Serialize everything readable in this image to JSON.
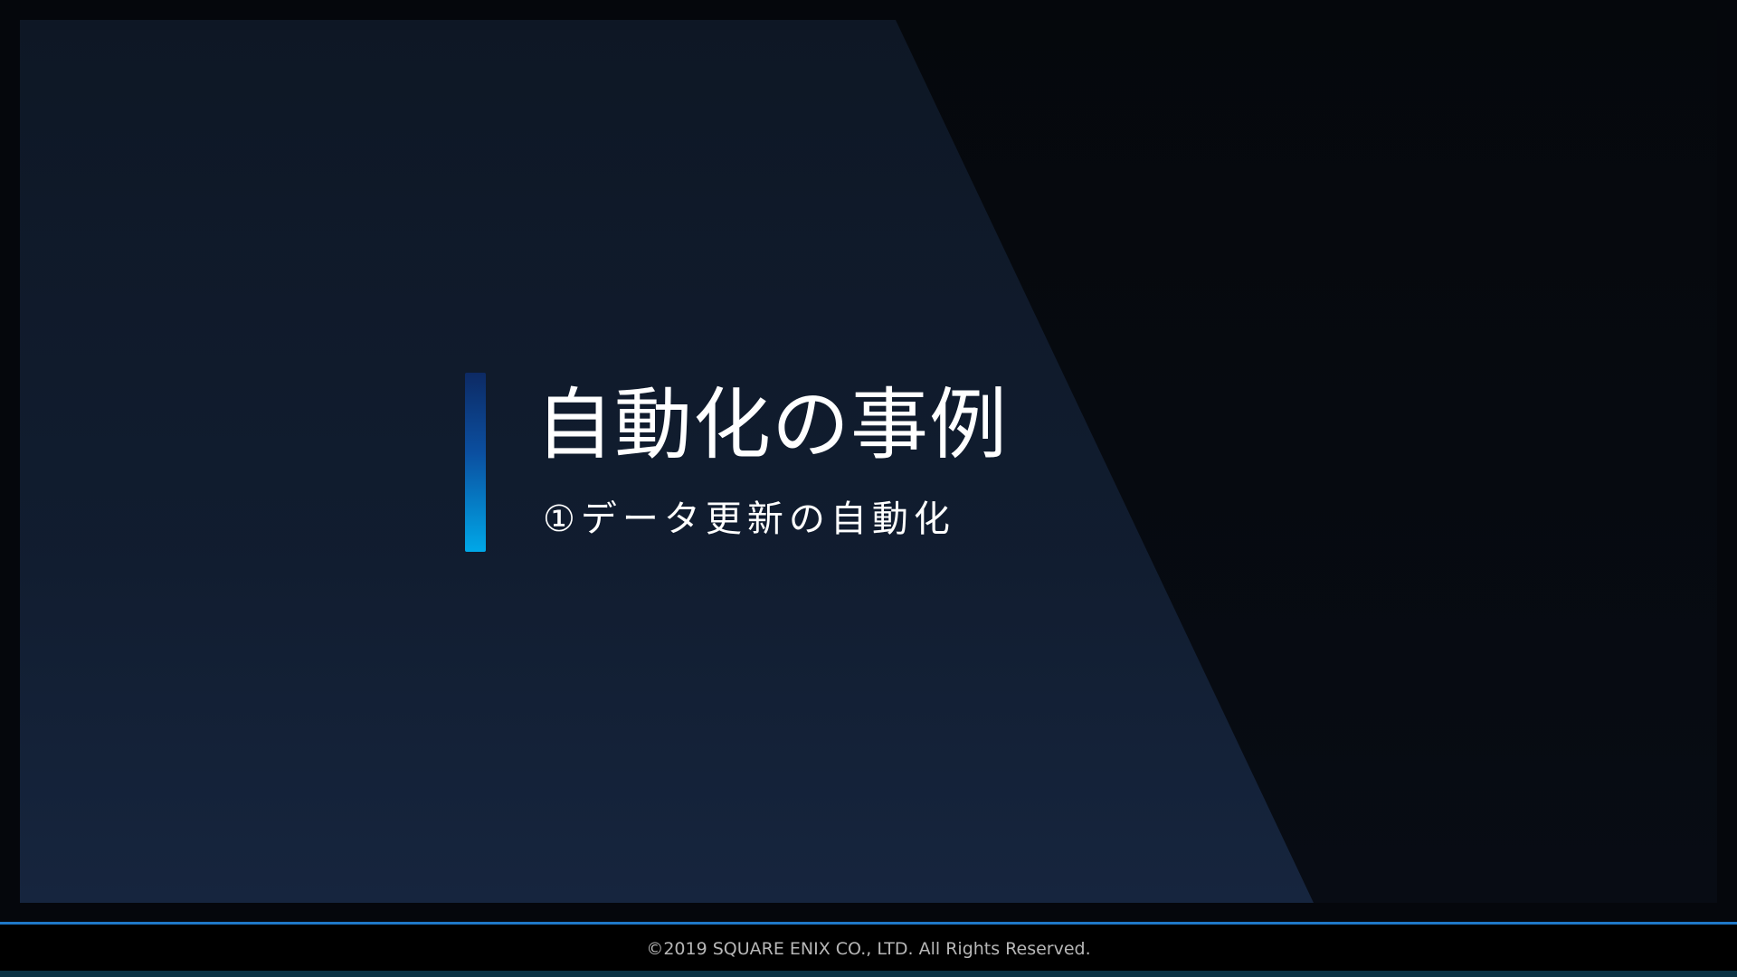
{
  "slide": {
    "title": "自動化の事例",
    "subtitle": "①データ更新の自動化",
    "footer": "©2019 SQUARE ENIX CO., LTD. All Rights Reserved."
  },
  "theme": {
    "background": "#05070c",
    "accent_top": "#0d2a64",
    "accent_bottom": "#00a8e8",
    "footer_line": "#1f78c8",
    "footer_text": "#b7b7b7",
    "text": "#ffffff"
  }
}
